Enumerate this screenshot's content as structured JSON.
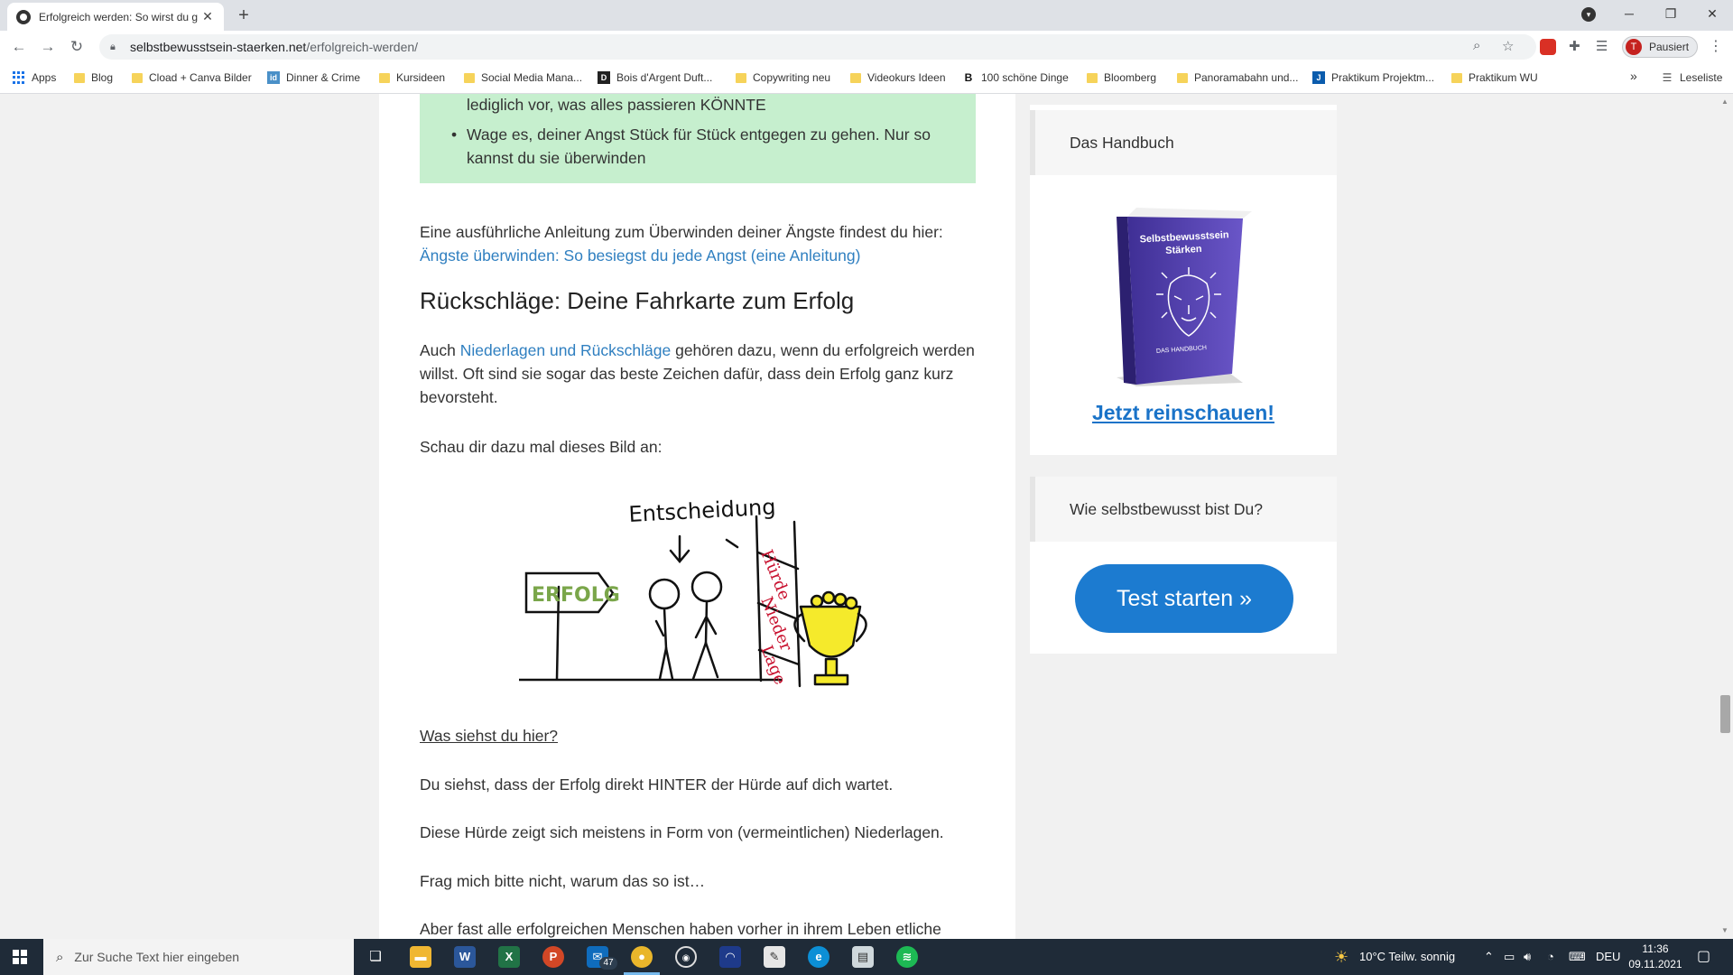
{
  "browser": {
    "tab_title": "Erfolgreich werden: So wirst du g",
    "url_host": "selbstbewusstsein-staerken.net",
    "url_path": "/erfolgreich-werden/",
    "profile_label": "Pausiert",
    "profile_initial": "T",
    "bookmarks": [
      {
        "label": "Apps",
        "kind": "apps"
      },
      {
        "label": "Blog",
        "kind": "folder"
      },
      {
        "label": "Cload + Canva Bilder",
        "kind": "folder"
      },
      {
        "label": "Dinner & Crime",
        "kind": "site"
      },
      {
        "label": "Kursideen",
        "kind": "folder"
      },
      {
        "label": "Social Media Mana...",
        "kind": "folder"
      },
      {
        "label": "Bois d'Argent Duft...",
        "kind": "site"
      },
      {
        "label": "Copywriting neu",
        "kind": "folder"
      },
      {
        "label": "Videokurs Ideen",
        "kind": "folder"
      },
      {
        "label": "100 schöne Dinge",
        "kind": "site"
      },
      {
        "label": "Bloomberg",
        "kind": "folder"
      },
      {
        "label": "Panoramabahn und...",
        "kind": "folder"
      },
      {
        "label": "Praktikum Projektm...",
        "kind": "site"
      },
      {
        "label": "Praktikum WU",
        "kind": "folder"
      }
    ],
    "more_bookmarks": "»",
    "reading_list": "Leseliste"
  },
  "article": {
    "tip_line1": "lediglich vor, was alles passieren KÖNNTE",
    "tip_line2": "Wage es, deiner Angst Stück für Stück entgegen zu gehen. Nur so kannst du sie überwinden",
    "p1_text": "Eine ausführliche Anleitung zum Überwinden deiner Ängste findest du hier:",
    "p1_link": "Ängste überwinden: So besiegst du jede Angst (eine Anleitung)",
    "heading": "Rückschläge: Deine Fahrkarte zum Erfolg",
    "p2_pre": "Auch ",
    "p2_link": "Niederlagen und Rückschläge",
    "p2_post": " gehören dazu, wenn du erfolgreich werden willst. Oft sind sie sogar das beste Zeichen dafür, dass dein Erfolg ganz kurz bevorsteht.",
    "p3": "Schau dir dazu mal dieses Bild an:",
    "sketch": {
      "entscheidung": "Entscheidung",
      "erfolg": "ERFOLG",
      "huerde": "Hürde",
      "nieder": "Nieder",
      "lage": "Lage"
    },
    "q": "Was siehst du hier?",
    "p4": "Du siehst, dass der Erfolg direkt HINTER der Hürde auf dich wartet.",
    "p5": "Diese Hürde zeigt sich meistens in Form von (vermeintlichen) Niederlagen.",
    "p6": "Frag mich bitte nicht, warum das so ist…",
    "p7": "Aber fast alle erfolgreichen Menschen haben vorher in ihrem Leben etliche"
  },
  "sidebar": {
    "widget1_title": "Das Handbuch",
    "book_title": "Selbstbewusstsein Stärken",
    "book_sub": "DAS HANDBUCH",
    "cta": "Jetzt reinschauen!",
    "widget2_title": "Wie selbstbewusst bist Du?",
    "test_button": "Test starten »"
  },
  "taskbar": {
    "search_placeholder": "Zur Suche Text hier eingeben",
    "mail_badge": "47",
    "weather": "10°C  Teilw. sonnig",
    "language": "DEU",
    "time": "11:36",
    "date": "09.11.2021"
  },
  "colors": {
    "tip_bg": "#c6efce",
    "link": "#2f7fc0",
    "button": "#1c7bd0"
  }
}
